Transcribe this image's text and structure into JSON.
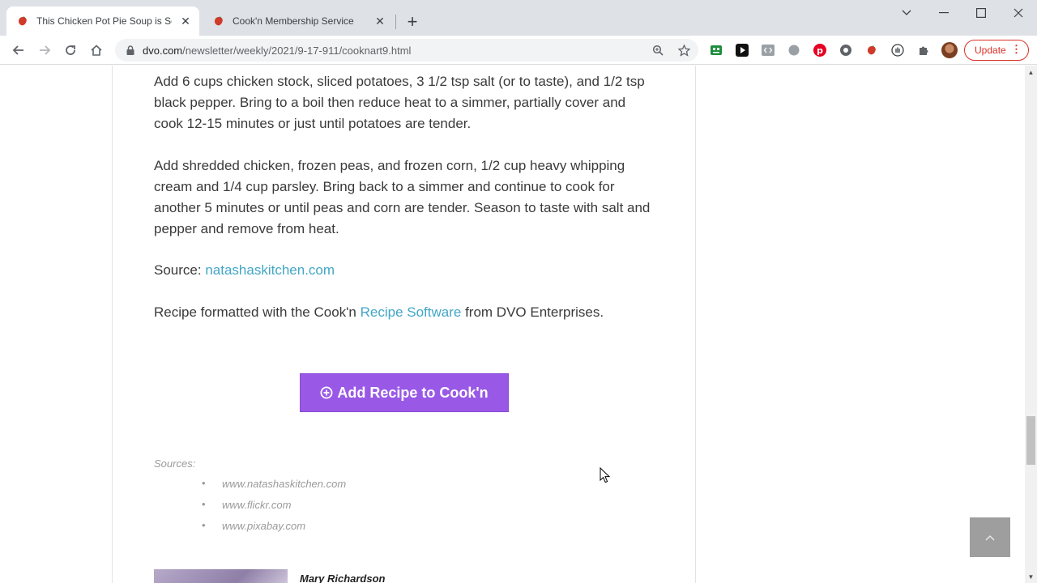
{
  "tabs": [
    {
      "title": "This Chicken Pot Pie Soup is So C",
      "active": true,
      "favicon": "cookn-strawberry-icon"
    },
    {
      "title": "Cook'n Membership Service",
      "active": false,
      "favicon": "cookn-strawberry-icon"
    }
  ],
  "window_controls": {
    "dropdown": "chevron-down-icon",
    "minimize": "minimize-icon",
    "maximize": "maximize-icon",
    "close": "close-icon"
  },
  "address_bar": {
    "domain": "dvo.com",
    "path": "/newsletter/weekly/2021/9-17-911/cooknart9.html"
  },
  "toolbar": {
    "update_label": "Update"
  },
  "colors": {
    "accent_button": "#9959e6",
    "link": "#43a6c6",
    "update": "#d93025"
  },
  "article": {
    "para1": "Add 6 cups chicken stock, sliced potatoes, 3 1/2 tsp salt (or to taste), and 1/2 tsp black pepper. Bring to a boil then reduce heat to a simmer, partially cover and cook 12-15 minutes or just until potatoes are tender.",
    "para2": "Add shredded chicken, frozen peas, and frozen corn, 1/2 cup heavy whipping cream and 1/4 cup parsley. Bring back to a simmer and continue to cook for another 5 minutes or until peas and corn are tender. Season to taste with salt and pepper and remove from heat.",
    "source_prefix": "Source:",
    "source_link": "natashaskitchen.com",
    "formatted_prefix": "Recipe formatted with the Cook'n",
    "formatted_link": "Recipe Software",
    "formatted_suffix": "from DVO Enterprises.",
    "cta_label": "Add Recipe to Cook'n",
    "sources_label": "Sources:",
    "sources": [
      "www.natashaskitchen.com",
      "www.flickr.com",
      "www.pixabay.com"
    ],
    "author_name": "Mary Richardson"
  }
}
